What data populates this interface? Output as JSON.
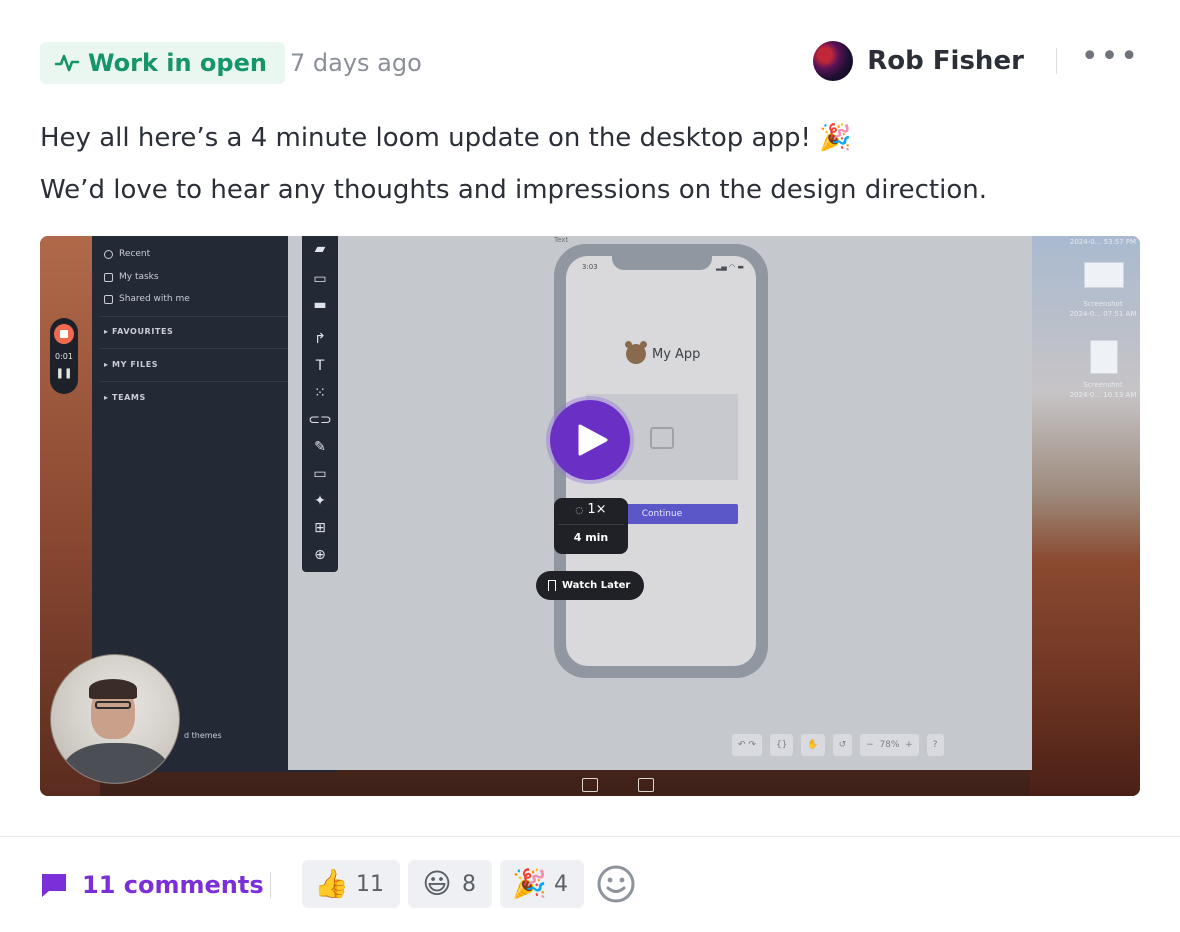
{
  "post": {
    "tag_label": "Work in open",
    "timestamp": "7 days ago",
    "author_name": "Rob Fisher",
    "more_label": "•••",
    "message_lines": [
      "Hey all here’s a 4 minute loom update on the desktop app! 🎉",
      "We’d love to hear any thoughts and impressions on the design direction."
    ]
  },
  "video": {
    "sidebar_items": [
      "Recent",
      "My tasks",
      "Shared with me"
    ],
    "sidebar_sections": [
      "FAVOURITES",
      "MY FILES",
      "TEAMS"
    ],
    "record_time": "0:01",
    "canvas_label": "Text",
    "app_title": "My App",
    "phone_time": "3:03",
    "continue_label": "Continue",
    "speed_label": "1×",
    "duration_label": "4 min",
    "watch_later_label": "Watch Later",
    "sidebar_footer": "d themes",
    "zoom_level": "78%",
    "help_label": "?",
    "desktop_files": [
      {
        "name": "Screenshot",
        "date": "2024-0... 53.57 PM"
      },
      {
        "name": "Screenshot",
        "date": "2024-0... 07.51 AM"
      },
      {
        "name": "Screenshot",
        "date": "2024-0... 10.13 AM"
      }
    ]
  },
  "footer": {
    "comments_label": "11 comments",
    "reactions": [
      {
        "emoji": "👍",
        "count": "11"
      },
      {
        "emoji": "😃",
        "count": "8"
      },
      {
        "emoji": "🎉",
        "count": "4"
      }
    ]
  },
  "colors": {
    "tag_green": "#16946a",
    "tag_bg": "#e9f7f0",
    "comments_purple": "#7b2fd8",
    "play_purple": "#6a2fc4"
  },
  "icons": {
    "tag": "activity-icon",
    "comments": "comment-icon",
    "add_reaction": "smiley-add-icon",
    "play": "play-icon",
    "more": "more-dots-icon"
  }
}
